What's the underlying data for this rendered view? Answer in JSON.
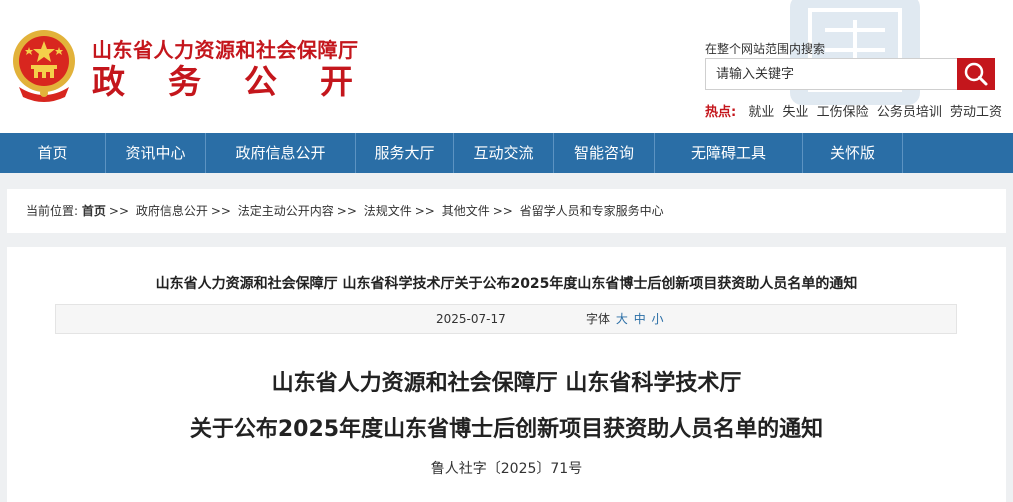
{
  "header": {
    "site_title": "山东省人力资源和社会保障厅",
    "site_subtitle": "政务公开",
    "search": {
      "hint": "在整个网站范围内搜索",
      "placeholder": "请输入关键字",
      "button_icon": "search-icon"
    },
    "hot": {
      "label": "热点:",
      "items": [
        "就业",
        "失业",
        "工伤保险",
        "公务员培训",
        "劳动工资"
      ]
    }
  },
  "nav": {
    "items": [
      "首页",
      "资讯中心",
      "政府信息公开",
      "服务大厅",
      "互动交流",
      "智能咨询",
      "无障碍工具",
      "关怀版"
    ]
  },
  "breadcrumb": {
    "prefix": "当前位置:",
    "items": [
      "首页",
      "政府信息公开",
      "法定主动公开内容",
      "法规文件",
      "其他文件",
      "省留学人员和专家服务中心"
    ],
    "separator": ">>"
  },
  "article": {
    "head": "山东省人力资源和社会保障厅 山东省科学技术厅关于公布2025年度山东省博士后创新项目获资助人员名单的通知",
    "date": "2025-07-17",
    "font_label": "字体",
    "font_sizes": [
      "大",
      "中",
      "小"
    ],
    "title_line1": "山东省人力资源和社会保障厅 山东省科学技术厅",
    "title_line2": "关于公布2025年度山东省博士后创新项目获资助人员名单的通知",
    "doc_number": "鲁人社字〔2025〕71号"
  },
  "colors": {
    "brand_red": "#c4161c",
    "nav_blue": "#2a6ea6",
    "page_bg": "#eef0f2"
  }
}
